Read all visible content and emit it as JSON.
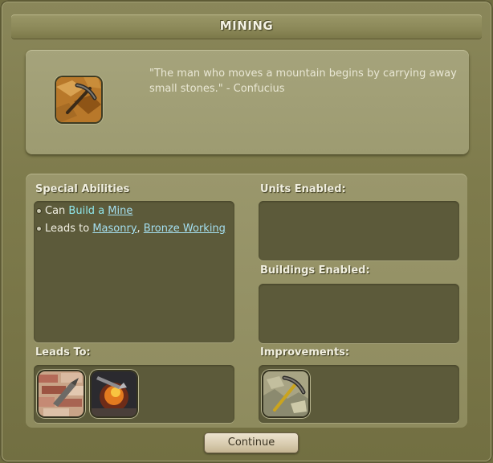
{
  "window": {
    "title": "MINING"
  },
  "tech": {
    "icon": "pickaxe-icon",
    "quote": "\"The man who moves a mountain begins by carrying away small stones.\" - Confucius"
  },
  "special_abilities": {
    "heading": "Special Abilities",
    "items": [
      {
        "prefix": "Can ",
        "highlight": "Build a ",
        "link": "Mine"
      },
      {
        "prefix": "Leads to ",
        "links": [
          "Masonry",
          "Bronze Working"
        ],
        "separator": ", "
      }
    ]
  },
  "units_enabled": {
    "heading": "Units Enabled:"
  },
  "buildings_enabled": {
    "heading": "Buildings Enabled:"
  },
  "leads_to": {
    "heading": "Leads To:",
    "items": [
      "masonry-tech-icon",
      "bronze-working-tech-icon"
    ]
  },
  "improvements": {
    "heading": "Improvements:",
    "items": [
      "mine-improvement-icon"
    ]
  },
  "buttons": {
    "continue": "Continue"
  },
  "colors": {
    "frame": "#7e7b4c",
    "inner_box": "#5c5a3a",
    "link": "#a4dff0",
    "highlight": "#8fe6ea"
  }
}
